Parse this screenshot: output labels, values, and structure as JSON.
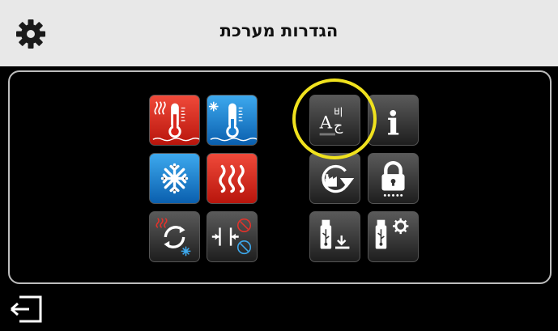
{
  "header": {
    "title": "הגדרות מערכת",
    "settings_icon": "gear-icon"
  },
  "grid": {
    "left": [
      {
        "name": "heating-temperature-button",
        "icon": "thermometer-heat-icon",
        "color": "#d9231a"
      },
      {
        "name": "cooling-temperature-button",
        "icon": "thermometer-cool-icon",
        "color": "#1b7fd0"
      },
      {
        "name": "cooling-mode-button",
        "icon": "snowflake-icon",
        "color": "#1b7fd0"
      },
      {
        "name": "heating-mode-button",
        "icon": "heat-waves-icon",
        "color": "#d9231a"
      },
      {
        "name": "changeover-button",
        "icon": "heat-cool-cycle-icon",
        "color": "#3a3a3a"
      },
      {
        "name": "deadband-button",
        "icon": "deadband-icon",
        "color": "#3a3a3a"
      }
    ],
    "right": [
      {
        "name": "language-button",
        "icon": "language-icon",
        "highlighted": true
      },
      {
        "name": "info-button",
        "icon": "info-icon"
      },
      {
        "name": "factory-reset-button",
        "icon": "factory-reset-icon"
      },
      {
        "name": "lock-button",
        "icon": "lock-icon"
      },
      {
        "name": "usb-download-button",
        "icon": "usb-download-icon"
      },
      {
        "name": "usb-settings-button",
        "icon": "usb-settings-icon"
      }
    ]
  },
  "language_glyphs": {
    "latin": "A",
    "hangul": "비",
    "arabic": "ج"
  },
  "info_glyph": "i",
  "footer": {
    "back_icon": "exit-icon"
  },
  "colors": {
    "highlight": "#f0e21e",
    "header_bg": "#e8e8e8",
    "border": "#bdbdbd"
  }
}
